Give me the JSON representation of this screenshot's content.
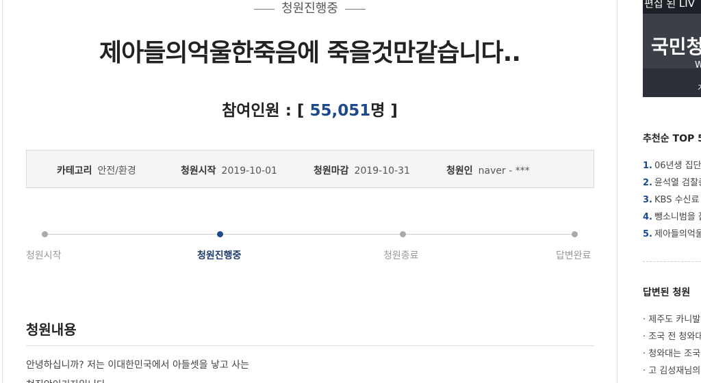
{
  "status_badge": "청원진행중",
  "title": "제아들의억울한죽음에 죽을것만같습니다..",
  "participants": {
    "label": "참여인원 : [ ",
    "count": "55,051",
    "unit": "명 ]"
  },
  "info": {
    "category_label": "카테고리",
    "category_value": "안전/환경",
    "start_label": "청원시작",
    "start_value": "2019-10-01",
    "end_label": "청원마감",
    "end_value": "2019-10-31",
    "author_label": "청원인",
    "author_value": "naver - ***"
  },
  "steps": [
    "청원시작",
    "청원진행중",
    "청원종료",
    "답변완료"
  ],
  "content": {
    "heading": "청원내용",
    "lines": [
      "안녕하십니까? 저는 이대한민국에서 아들셋을 낳고 사는",
      "천진안이기자입니다"
    ]
  },
  "sidebar": {
    "banner": {
      "top_text": "편집 된 LIV",
      "main_text": "국민청",
      "sub1": "W",
      "sub2": "가"
    },
    "top5_heading": "추천순 TOP 5",
    "top5": [
      {
        "rank": "1.",
        "text": "06년생 집단"
      },
      {
        "rank": "2.",
        "text": "윤석열 검찰총"
      },
      {
        "rank": "3.",
        "text": "KBS 수신료"
      },
      {
        "rank": "4.",
        "text": "뺑소니범을 잡"
      },
      {
        "rank": "5.",
        "text": "제아들의억울"
      }
    ],
    "answered_heading": "답변된 청원",
    "answered": [
      "· 제주도 카니발",
      "· 조국 전 청와대",
      "· 청와대는 조국",
      "· 고 김성재님의"
    ]
  },
  "colors": {
    "accent": "#1c4a8c",
    "border": "#d9d9d9",
    "box_bg": "#f5f5f5"
  }
}
